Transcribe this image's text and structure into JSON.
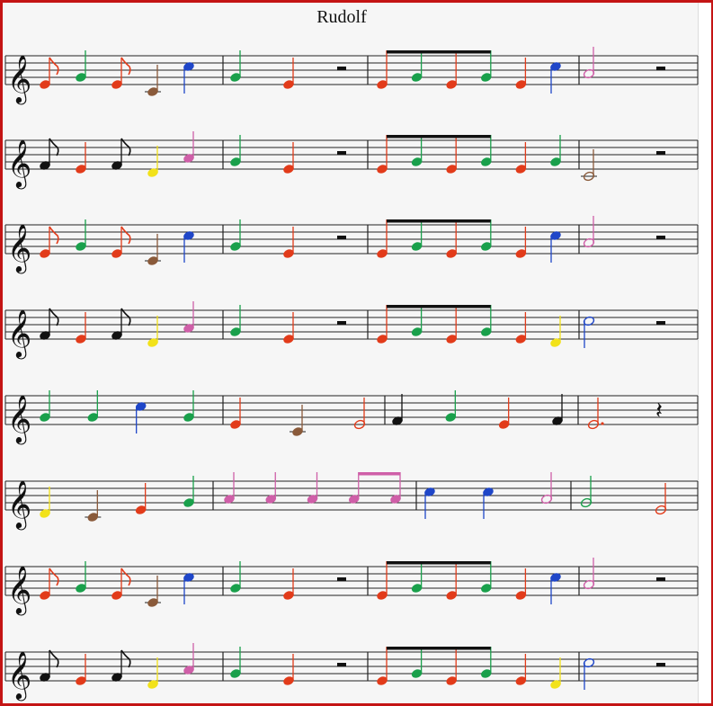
{
  "title": "Rudolf",
  "colors": {
    "C": "#8a5a3a",
    "D": "#f2e21a",
    "E": "#e23b1a",
    "F": "#111111",
    "G": "#19a04b",
    "A": "#cf5fa8",
    "B": "#1f46c8",
    "c": "#1f46c8"
  },
  "systems": [
    {
      "measures": [
        [
          [
            "E",
            "8"
          ],
          [
            "G",
            "q"
          ],
          [
            "E",
            "8"
          ],
          [
            "C",
            "q"
          ],
          [
            "c",
            "q"
          ]
        ],
        [
          [
            "G",
            "q"
          ],
          [
            "E",
            "q"
          ],
          [
            "R",
            "hr"
          ]
        ],
        [
          [
            "E",
            "8b"
          ],
          [
            "G",
            "8b"
          ],
          [
            "E",
            "8b"
          ],
          [
            "G",
            "8b"
          ],
          [
            "E",
            "q"
          ],
          [
            "c",
            "q"
          ]
        ],
        [
          [
            "A",
            "h"
          ],
          [
            "R",
            "hr"
          ]
        ]
      ]
    },
    {
      "measures": [
        [
          [
            "F",
            "8"
          ],
          [
            "E",
            "q"
          ],
          [
            "F",
            "8"
          ],
          [
            "D",
            "q"
          ],
          [
            "A",
            "q"
          ]
        ],
        [
          [
            "G",
            "q"
          ],
          [
            "E",
            "q"
          ],
          [
            "R",
            "hr"
          ]
        ],
        [
          [
            "E",
            "8b"
          ],
          [
            "G",
            "8b"
          ],
          [
            "E",
            "8b"
          ],
          [
            "G",
            "8b"
          ],
          [
            "E",
            "q"
          ],
          [
            "G",
            "q"
          ]
        ],
        [
          [
            "C",
            "h"
          ],
          [
            "R",
            "hr"
          ]
        ]
      ]
    },
    {
      "measures": [
        [
          [
            "E",
            "8"
          ],
          [
            "G",
            "q"
          ],
          [
            "E",
            "8"
          ],
          [
            "C",
            "q"
          ],
          [
            "c",
            "q"
          ]
        ],
        [
          [
            "G",
            "q"
          ],
          [
            "E",
            "q"
          ],
          [
            "R",
            "hr"
          ]
        ],
        [
          [
            "E",
            "8b"
          ],
          [
            "G",
            "8b"
          ],
          [
            "E",
            "8b"
          ],
          [
            "G",
            "8b"
          ],
          [
            "E",
            "q"
          ],
          [
            "c",
            "q"
          ]
        ],
        [
          [
            "A",
            "h"
          ],
          [
            "R",
            "hr"
          ]
        ]
      ]
    },
    {
      "measures": [
        [
          [
            "F",
            "8"
          ],
          [
            "E",
            "q"
          ],
          [
            "F",
            "8"
          ],
          [
            "D",
            "q"
          ],
          [
            "A",
            "q"
          ]
        ],
        [
          [
            "G",
            "q"
          ],
          [
            "E",
            "q"
          ],
          [
            "R",
            "hr"
          ]
        ],
        [
          [
            "E",
            "8b"
          ],
          [
            "G",
            "8b"
          ],
          [
            "E",
            "8b"
          ],
          [
            "G",
            "8b"
          ],
          [
            "E",
            "q"
          ],
          [
            "D",
            "q"
          ]
        ],
        [
          [
            "c",
            "h"
          ],
          [
            "R",
            "hr"
          ]
        ]
      ]
    },
    {
      "measures": [
        [
          [
            "G",
            "q"
          ],
          [
            "G",
            "q"
          ],
          [
            "c",
            "q"
          ],
          [
            "G",
            "q"
          ]
        ],
        [
          [
            "E",
            "q"
          ],
          [
            "C",
            "q"
          ],
          [
            "E",
            "h"
          ]
        ],
        [
          [
            "F",
            "q"
          ],
          [
            "G",
            "q"
          ],
          [
            "E",
            "q"
          ],
          [
            "F",
            "q"
          ]
        ],
        [
          [
            "E",
            "hd"
          ],
          [
            "R",
            "qr"
          ]
        ]
      ]
    },
    {
      "measures": [
        [
          [
            "D",
            "q"
          ],
          [
            "C",
            "q"
          ],
          [
            "E",
            "q"
          ],
          [
            "G",
            "q"
          ]
        ],
        [
          [
            "A",
            "q"
          ],
          [
            "A",
            "q"
          ],
          [
            "A",
            "q"
          ],
          [
            "A",
            "8b"
          ],
          [
            "A",
            "8b"
          ]
        ],
        [
          [
            "c",
            "q"
          ],
          [
            "c",
            "q"
          ],
          [
            "A",
            "h"
          ]
        ],
        [
          [
            "G",
            "h"
          ],
          [
            "E",
            "h"
          ]
        ]
      ]
    },
    {
      "measures": [
        [
          [
            "E",
            "8"
          ],
          [
            "G",
            "q"
          ],
          [
            "E",
            "8"
          ],
          [
            "C",
            "q"
          ],
          [
            "c",
            "q"
          ]
        ],
        [
          [
            "G",
            "q"
          ],
          [
            "E",
            "q"
          ],
          [
            "R",
            "hr"
          ]
        ],
        [
          [
            "E",
            "8b"
          ],
          [
            "G",
            "8b"
          ],
          [
            "E",
            "8b"
          ],
          [
            "G",
            "8b"
          ],
          [
            "E",
            "q"
          ],
          [
            "c",
            "q"
          ]
        ],
        [
          [
            "A",
            "h"
          ],
          [
            "R",
            "hr"
          ]
        ]
      ]
    },
    {
      "measures": [
        [
          [
            "F",
            "8"
          ],
          [
            "E",
            "q"
          ],
          [
            "F",
            "8"
          ],
          [
            "D",
            "q"
          ],
          [
            "A",
            "q"
          ]
        ],
        [
          [
            "G",
            "q"
          ],
          [
            "E",
            "q"
          ],
          [
            "R",
            "hr"
          ]
        ],
        [
          [
            "E",
            "8b"
          ],
          [
            "G",
            "8b"
          ],
          [
            "E",
            "8b"
          ],
          [
            "G",
            "8b"
          ],
          [
            "E",
            "q"
          ],
          [
            "D",
            "q"
          ]
        ],
        [
          [
            "c",
            "h"
          ],
          [
            "R",
            "hr"
          ]
        ]
      ]
    }
  ]
}
